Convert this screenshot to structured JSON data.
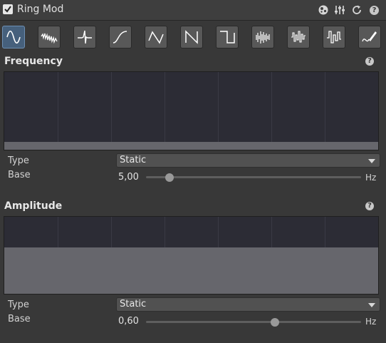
{
  "header": {
    "title": "Ring Mod",
    "enabled": true,
    "icons": [
      "presets-icon",
      "sliders-icon",
      "reset-icon",
      "help-icon"
    ]
  },
  "waveforms": {
    "selected": 0,
    "items": [
      "sine-wave-icon",
      "noise-wave-icon",
      "pulse-wave-icon",
      "curve-wave-icon",
      "triangle-wave-icon",
      "sawtooth-wave-icon",
      "square-wave-icon",
      "random-wave-icon",
      "random-steps-icon",
      "random-square-icon",
      "draw-curve-icon"
    ]
  },
  "frequency": {
    "title": "Frequency",
    "type_label": "Type",
    "type_value": "Static",
    "base_label": "Base",
    "base_value": "5,00",
    "unit": "Hz",
    "slider_fraction": 0.11,
    "graph_level": 0.1
  },
  "amplitude": {
    "title": "Amplitude",
    "type_label": "Type",
    "type_value": "Static",
    "base_label": "Base",
    "base_value": "0,60",
    "unit": "Hz",
    "slider_fraction": 0.6,
    "graph_level": 0.6
  }
}
